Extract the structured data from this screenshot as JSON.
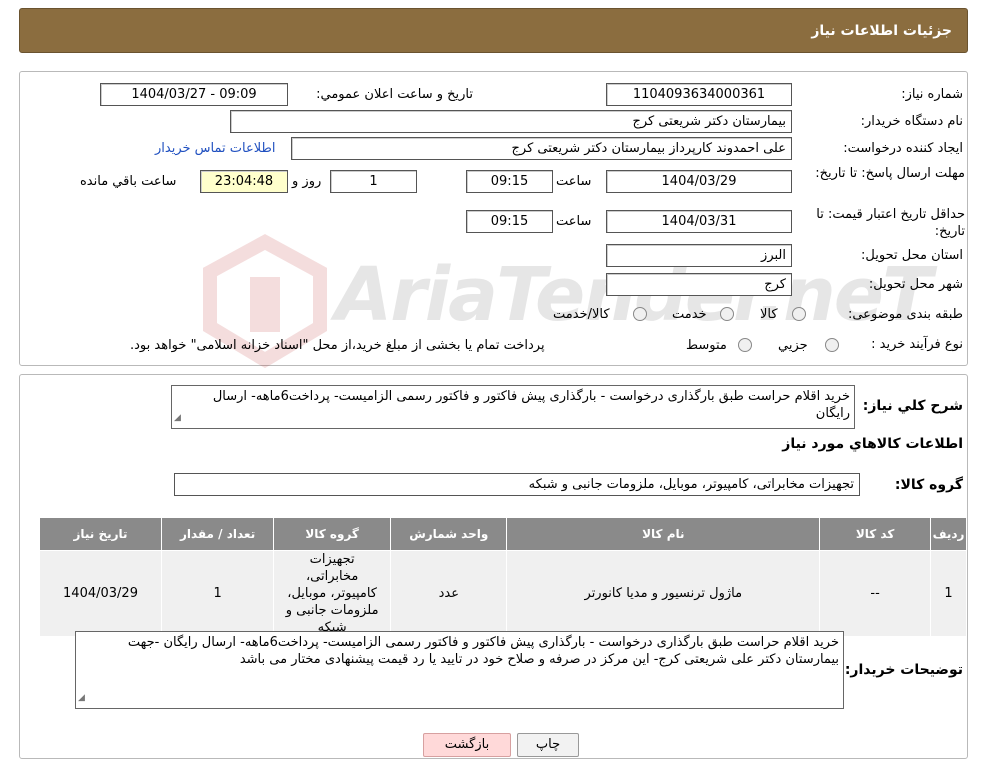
{
  "header": {
    "title": "جزئیات اطلاعات نیاز"
  },
  "form": {
    "need_number_label": "شماره نیاز:",
    "need_number": "1104093634000361",
    "announce_label": "تاریخ و ساعت اعلان عمومي:",
    "announce_value": "1404/03/27 - 09:09",
    "buyer_org_label": "نام دستگاه خريدار:",
    "buyer_org": "بیمارستان دکتر شریعتی کرج",
    "creator_label": "ايجاد کننده درخواست:",
    "creator": "علی احمدوند کارپرداز بیمارستان دکتر شریعتی کرج",
    "contact_link": "اطلاعات تماس خريدار",
    "deadline_label": "مهلت ارسال پاسخ: تا تاریخ:",
    "deadline_date": "1404/03/29",
    "time_label": "ساعت",
    "deadline_time": "09:15",
    "days_value": "1",
    "days_label": "روز و",
    "remaining_time": "23:04:48",
    "remaining_label": "ساعت باقي مانده",
    "validity_label": "حداقل تاريخ اعتبار قيمت: تا تاریخ:",
    "validity_date": "1404/03/31",
    "validity_time": "09:15",
    "province_label": "استان محل تحويل:",
    "province": "البرز",
    "city_label": "شهر محل تحويل:",
    "city": "کرج",
    "category_label": "طبقه بندی موضوعی:",
    "category_options": [
      "کالا",
      "خدمت",
      "کالا/خدمت"
    ],
    "process_label": "نوع فرآيند خريد :",
    "process_options": [
      "جزیي",
      "متوسط"
    ],
    "process_note": "پرداخت تمام يا بخشی از مبلغ خريد،از محل \"اسناد خزانه اسلامی\" خواهد بود."
  },
  "details": {
    "summary_label": "شرح کلي نياز:",
    "summary": "خرید اقلام حراست طبق بارگذاری درخواست  - بارگذاری  پیش فاکتور و فاکتور رسمی الزامیست- پرداخت6ماهه- ارسال رایگان",
    "goods_info_title": "اطلاعات کالاهاي مورد نياز",
    "group_label": "گروه کالا:",
    "group_value": "تجهیزات مخابراتی، کامپیوتر، موبایل، ملزومات جانبی و شبکه",
    "table_headers": [
      "رديف",
      "کد کالا",
      "نام کالا",
      "واحد شمارش",
      "گروه کالا",
      "تعداد / مقدار",
      "تاريخ نياز"
    ],
    "rows": [
      {
        "index": "1",
        "code": "--",
        "name": "ماژول ترنسیور و مدیا کانورتر",
        "unit": "عدد",
        "group": "تجهیزات مخابراتی، کامپیوتر، موبایل، ملزومات جانبی و شبکه",
        "qty": "1",
        "date": "1404/03/29"
      }
    ],
    "buyer_notes_label": "توضيحات خريدار:",
    "buyer_notes": "خرید اقلام حراست طبق بارگذاری درخواست  - بارگذاری  پیش فاکتور و فاکتور رسمی الزامیست- پرداخت6ماهه- ارسال رایگان -جهت بیمارستان دکتر علی شریعتی کرج- این مرکز در صرفه و صلاح خود در تایید یا رد قیمت پیشنهادی مختار می باشد"
  },
  "buttons": {
    "print": "چاپ",
    "back": "بازگشت"
  },
  "watermark": {
    "text": "AriaTender.neT"
  }
}
